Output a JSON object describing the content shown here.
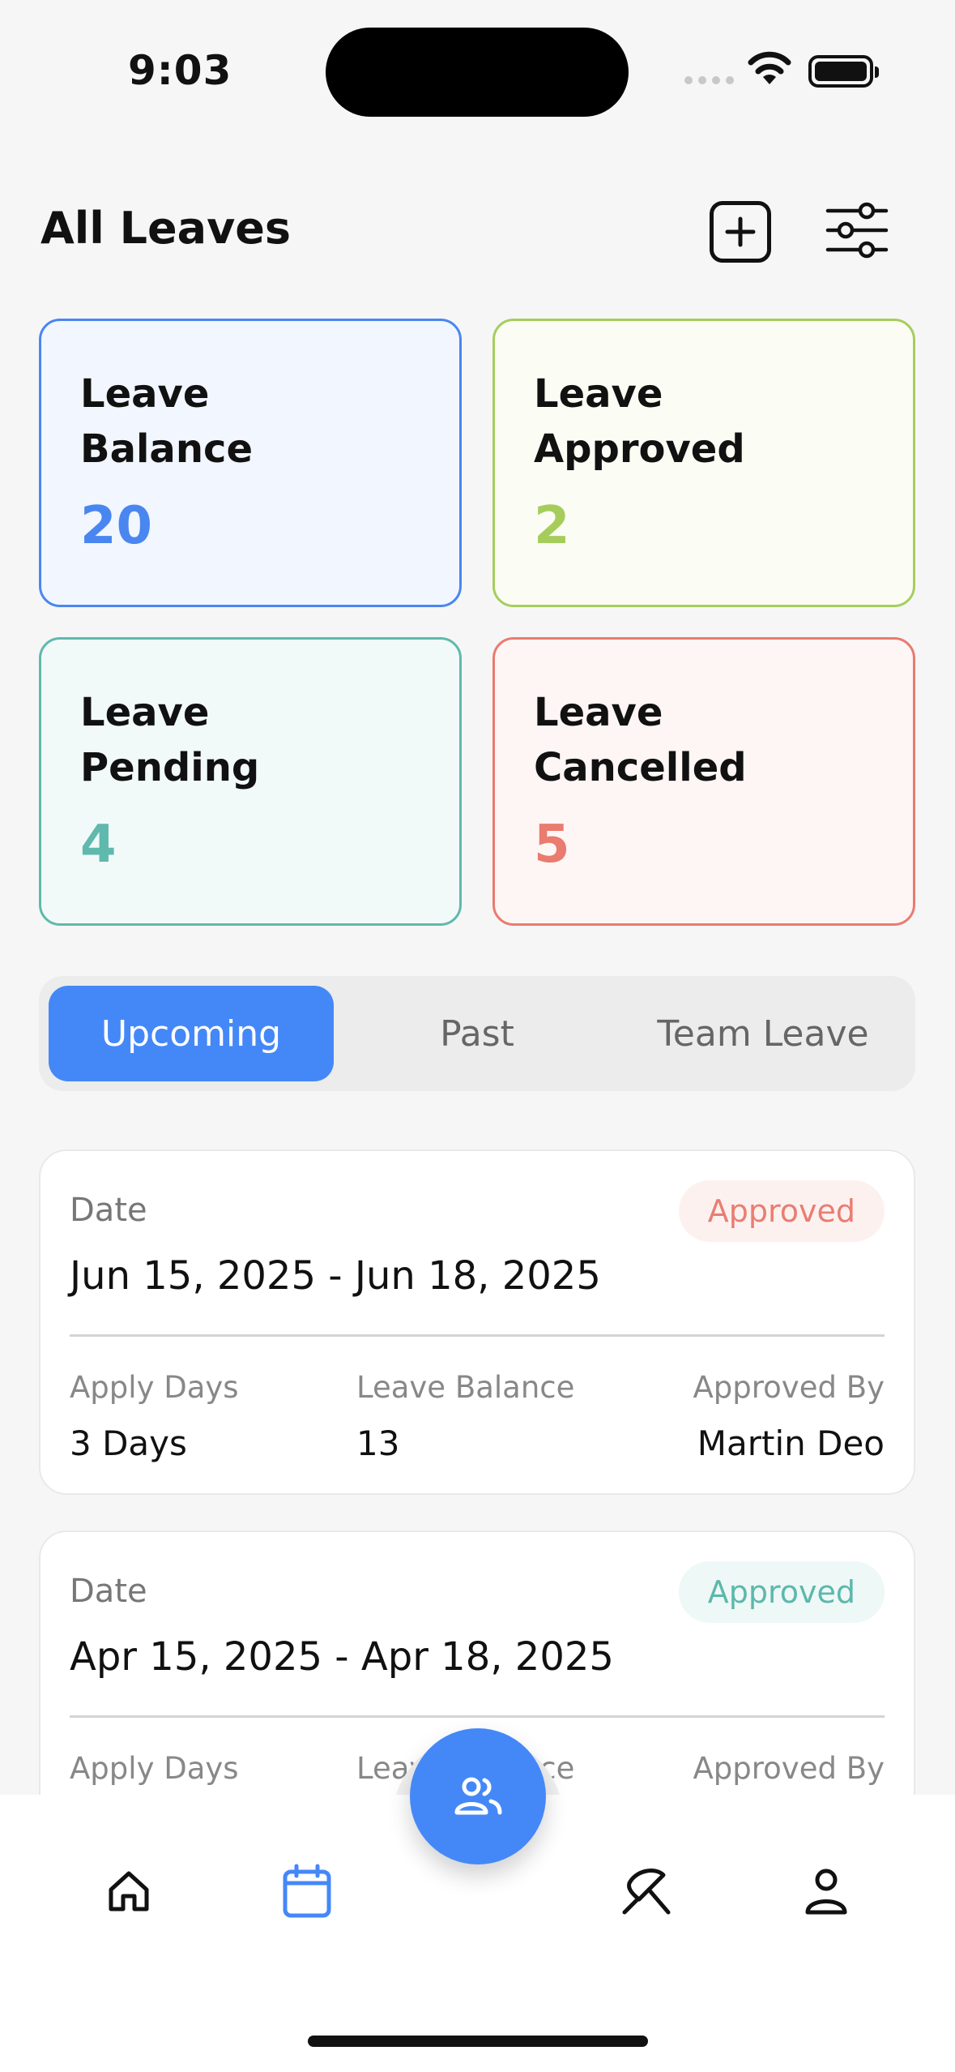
{
  "status_bar": {
    "time": "9:03"
  },
  "header": {
    "title": "All Leaves"
  },
  "stats": {
    "balance": {
      "label": "Leave Balance",
      "value": "20"
    },
    "approved": {
      "label": "Leave Approved",
      "value": "2"
    },
    "pending": {
      "label": "Leave Pending",
      "value": "4"
    },
    "cancelled": {
      "label": "Leave Cancelled",
      "value": "5"
    }
  },
  "tabs": [
    {
      "label": "Upcoming",
      "active": true
    },
    {
      "label": "Past",
      "active": false
    },
    {
      "label": "Team Leave",
      "active": false
    }
  ],
  "leaves": [
    {
      "date_label": "Date",
      "dates": "Jun 15, 2025 - Jun 18, 2025",
      "status": "Approved",
      "apply_days_label": "Apply Days",
      "apply_days": "3 Days",
      "balance_label": "Leave Balance",
      "balance": "13",
      "approved_by_label": "Approved By",
      "approved_by": "Martin Deo"
    },
    {
      "date_label": "Date",
      "dates": "Apr 15, 2025 - Apr 18, 2025",
      "status": "Approved",
      "apply_days_label": "Apply Days",
      "balance_label": "Leave Balance",
      "approved_by_label": "Approved By"
    }
  ],
  "colors": {
    "primary": "#4488f8",
    "balance": "#4a86f0",
    "approved": "#a6cd5c",
    "pending": "#5fb9ad",
    "cancelled": "#e97b6f"
  },
  "nav": {
    "items": [
      "home-icon",
      "calendar-icon",
      "team-icon",
      "beach-umbrella-icon",
      "profile-icon"
    ],
    "active": "calendar-icon"
  }
}
